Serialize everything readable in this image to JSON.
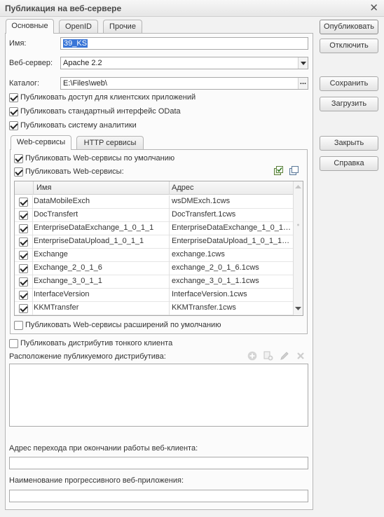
{
  "window": {
    "title": "Публикация на веб-сервере"
  },
  "tabs": [
    "Основные",
    "OpenID",
    "Прочие"
  ],
  "main": {
    "name_label": "Имя:",
    "name_value": "39_KS",
    "server_label": "Веб-сервер:",
    "server_value": "Apache 2.2",
    "catalog_label": "Каталог:",
    "catalog_value": "E:\\Files\\web\\",
    "checks": [
      {
        "label": "Публиковать доступ для клиентских приложений",
        "checked": true
      },
      {
        "label": "Публиковать стандартный интерфейс OData",
        "checked": true
      },
      {
        "label": "Публиковать систему аналитики",
        "checked": true
      }
    ]
  },
  "inner_tabs": [
    "Web-сервисы",
    "HTTP сервисы"
  ],
  "web_services": {
    "default_label": "Публиковать Web-сервисы по умолчанию",
    "publish_label": "Публиковать Web-сервисы:",
    "columns": [
      "Имя",
      "Адрес"
    ],
    "rows": [
      {
        "name": "DataMobileExch",
        "address": "wsDMExch.1cws"
      },
      {
        "name": "DocTransfert",
        "address": "DocTransfert.1cws"
      },
      {
        "name": "EnterpriseDataExchange_1_0_1_1",
        "address": "EnterpriseDataExchange_1_0_1_..."
      },
      {
        "name": "EnterpriseDataUpload_1_0_1_1",
        "address": "EnterpriseDataUpload_1_0_1_1.1..."
      },
      {
        "name": "Exchange",
        "address": "exchange.1cws"
      },
      {
        "name": "Exchange_2_0_1_6",
        "address": "exchange_2_0_1_6.1cws"
      },
      {
        "name": "Exchange_3_0_1_1",
        "address": "exchange_3_0_1_1.1cws"
      },
      {
        "name": "InterfaceVersion",
        "address": "InterfaceVersion.1cws"
      },
      {
        "name": "KKMTransfer",
        "address": "KKMTransfer.1cws"
      }
    ],
    "extensions_label": "Публиковать Web-сервисы расширений по умолчанию"
  },
  "thin_client": {
    "publish_label": "Публиковать дистрибутив тонкого клиента",
    "location_label": "Расположение публикуемого дистрибутива:"
  },
  "redirect_label": "Адрес перехода при окончании работы веб-клиента:",
  "pwa_label": "Наименование прогрессивного веб-приложения:",
  "buttons": {
    "publish": "Опубликовать",
    "unpublish": "Отключить",
    "save": "Сохранить",
    "load": "Загрузить",
    "close": "Закрыть",
    "help": "Справка"
  },
  "close_glyph": "✕"
}
